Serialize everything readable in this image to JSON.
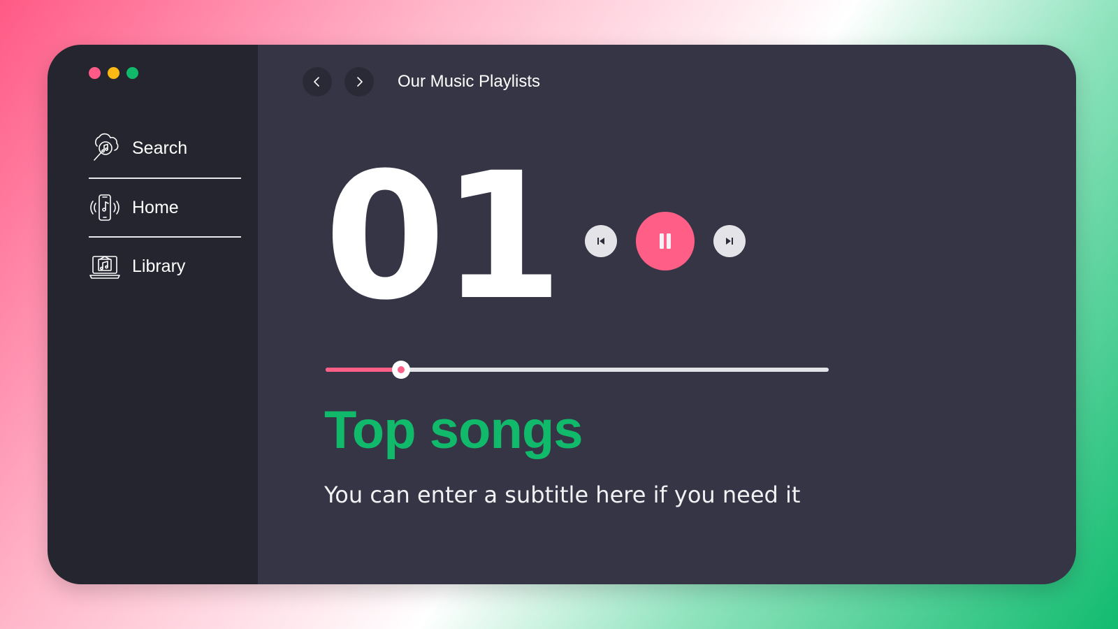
{
  "window": {
    "controls": [
      "close",
      "minimize",
      "maximize"
    ]
  },
  "sidebar": {
    "items": [
      {
        "label": "Search",
        "icon": "music-search-icon"
      },
      {
        "label": "Home",
        "icon": "phone-music-icon"
      },
      {
        "label": "Library",
        "icon": "laptop-music-icon"
      }
    ]
  },
  "topbar": {
    "title": "Our Music Playlists",
    "back_icon": "chevron-left-icon",
    "forward_icon": "chevron-right-icon"
  },
  "player": {
    "number": "01",
    "state": "playing",
    "progress": 0.15
  },
  "content": {
    "heading": "Top songs",
    "subtitle": "You can enter a subtitle here if you need it"
  },
  "colors": {
    "accent_pink": "#ff5f87",
    "accent_green": "#11b96b",
    "sidebar_bg": "#25252f",
    "main_bg": "#353545"
  }
}
